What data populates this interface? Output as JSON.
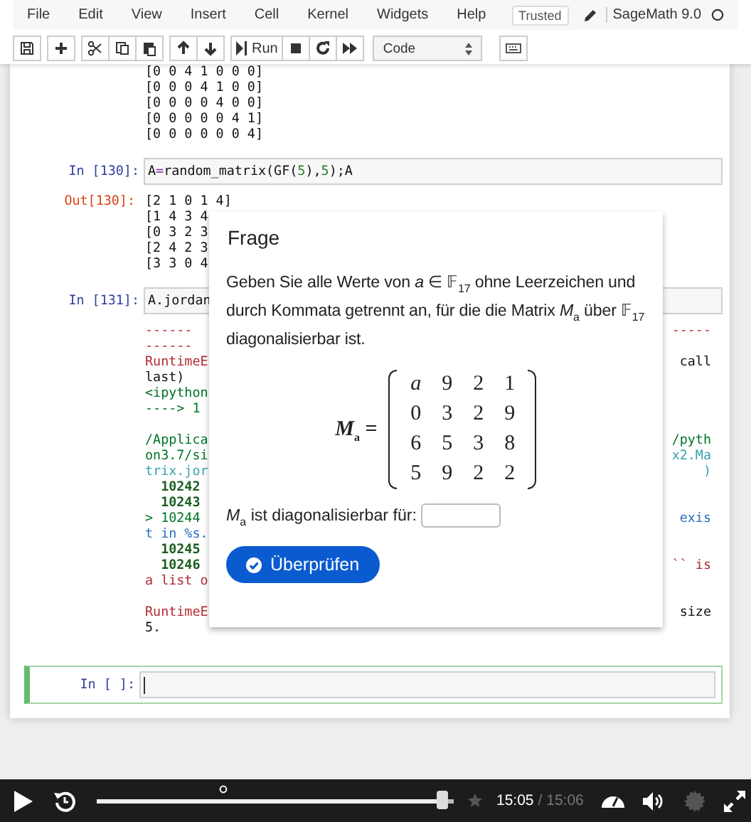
{
  "menu": [
    "File",
    "Edit",
    "View",
    "Insert",
    "Cell",
    "Kernel",
    "Widgets",
    "Help"
  ],
  "trusted": "Trusted",
  "kernel": "SageMath 9.0",
  "toolbar": {
    "run": "Run",
    "cell_type": "Code"
  },
  "cells": [
    {
      "kind": "output",
      "blocks": [
        [
          {
            "left": {
              "text": "[0 0 4 1 0 0 0]",
              "kind": "plain"
            }
          },
          {
            "left": {
              "text": "[0 0 0 4 1 0 0]",
              "kind": "plain"
            }
          },
          {
            "left": {
              "text": "[0 0 0 0 4 0 0]",
              "kind": "plain"
            }
          },
          {
            "left": {
              "text": "[0 0 0 0 0 4 1]",
              "kind": "plain"
            }
          },
          {
            "left": {
              "text": "[0 0 0 0 0 0 4]",
              "kind": "plain"
            }
          }
        ]
      ]
    },
    {
      "kind": "input",
      "prompt": "In [130]:",
      "selected": false,
      "tokens": [
        {
          "text": "A",
          "kind": "plain"
        },
        {
          "text": "=",
          "kind": "op"
        },
        {
          "text": "random_matrix(GF(",
          "kind": "plain"
        },
        {
          "text": "5",
          "kind": "num"
        },
        {
          "text": "),",
          "kind": "plain"
        },
        {
          "text": "5",
          "kind": "num"
        },
        {
          "text": ");A",
          "kind": "plain"
        }
      ]
    },
    {
      "kind": "output",
      "prompt": "Out[130]:",
      "blocks": [
        [
          {
            "left": {
              "text": "[2 1 0 1 4]",
              "kind": "plain"
            }
          },
          {
            "left": {
              "text": "[1 4 3 4",
              "kind": "plain"
            }
          },
          {
            "left": {
              "text": "[0 3 2 3",
              "kind": "plain"
            }
          },
          {
            "left": {
              "text": "[2 4 2 3",
              "kind": "plain"
            }
          },
          {
            "left": {
              "text": "[3 3 0 4",
              "kind": "plain"
            }
          }
        ]
      ]
    },
    {
      "kind": "input",
      "prompt": "In [131]:",
      "selected": false,
      "tokens": [
        {
          "text": "A.jordan",
          "kind": "plain"
        }
      ]
    },
    {
      "kind": "output",
      "blocks": [
        [
          {
            "left": {
              "text": "------",
              "kind": "error"
            },
            "right": {
              "text": "-----",
              "kind": "error"
            }
          },
          {
            "left": {
              "text": "------",
              "kind": "error"
            }
          },
          {
            "left": {
              "text": "RuntimeE",
              "kind": "error"
            },
            "right": {
              "text": "call",
              "kind": "plain"
            }
          },
          {
            "left": {
              "text": "last)",
              "kind": "plain"
            }
          },
          {
            "left": {
              "text": "<ipython",
              "kind": "green"
            }
          },
          {
            "left": {
              "text": "----> 1",
              "kind": "green"
            }
          }
        ],
        [
          {
            "left": {
              "text": "/Applica",
              "kind": "green"
            },
            "right": {
              "text": "/pyth",
              "kind": "green"
            }
          },
          {
            "left": {
              "text": "on3.7/si",
              "kind": "green"
            },
            "right": {
              "text": "x2.Ma",
              "kind": "cyan"
            }
          },
          {
            "left": {
              "text": "trix.jor",
              "kind": "cyan"
            },
            "right": {
              "text": ")",
              "kind": "cyan"
            }
          },
          {
            "left": {
              "text": "  10242",
              "kind": "lineno"
            }
          },
          {
            "left": {
              "text": "  10243",
              "kind": "lineno"
            }
          },
          {
            "left": {
              "text": "> 10244",
              "kind": "green"
            },
            "right": {
              "text": "exis",
              "kind": "blue"
            }
          },
          {
            "left": {
              "text": "t in %s.",
              "kind": "blue"
            }
          },
          {
            "left": {
              "text": "  10245",
              "kind": "lineno"
            }
          },
          {
            "left": {
              "text": "  10246",
              "kind": "lineno"
            },
            "right": {
              "text": "`` is",
              "kind": "error"
            }
          },
          {
            "left": {
              "text": "a list o",
              "kind": "error"
            }
          }
        ],
        [
          {
            "left": {
              "text": "RuntimeE",
              "kind": "error"
            },
            "right": {
              "text": "size",
              "kind": "plain"
            }
          },
          {
            "left": {
              "text": "5.",
              "kind": "plain"
            }
          }
        ]
      ]
    },
    {
      "kind": "input",
      "prompt": "In [ ]:",
      "selected": true
    }
  ],
  "dialog": {
    "title": "Frage",
    "question": "Geben Sie alle Werte von *a* ∈ 𝔽$_{17}$ ohne Leerzeichen und durch Kommata getrennt an, für die die Matrix *M*$_{a}$ über 𝔽$_{17}$ diagonalisierbar ist.",
    "matrix_label": "*M*$_{a}$ =",
    "matrix": [
      [
        "*a*",
        "9",
        "2",
        "1"
      ],
      [
        "0",
        "3",
        "2",
        "9"
      ],
      [
        "6",
        "5",
        "3",
        "8"
      ],
      [
        "5",
        "9",
        "2",
        "2"
      ]
    ],
    "answer_label": "*M*$_{a}$ ist diagonalisierbar für:",
    "check_button": "Überprüfen"
  },
  "player": {
    "level": 0.97,
    "time": "15:05",
    "duration": "/ 15:06"
  }
}
